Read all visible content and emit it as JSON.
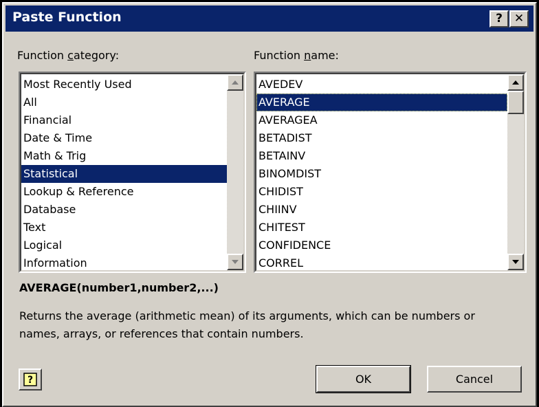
{
  "window": {
    "title": "Paste Function",
    "help_button_label": "?",
    "close_button_label": "✕"
  },
  "category": {
    "label_prefix": "Function ",
    "label_accel": "c",
    "label_suffix": "ategory:",
    "items": [
      "Most Recently Used",
      "All",
      "Financial",
      "Date & Time",
      "Math & Trig",
      "Statistical",
      "Lookup & Reference",
      "Database",
      "Text",
      "Logical",
      "Information"
    ],
    "selected": "Statistical"
  },
  "function": {
    "label_prefix": "Function ",
    "label_accel": "n",
    "label_suffix": "ame:",
    "items": [
      "AVEDEV",
      "AVERAGE",
      "AVERAGEA",
      "BETADIST",
      "BETAINV",
      "BINOMDIST",
      "CHIDIST",
      "CHIINV",
      "CHITEST",
      "CONFIDENCE",
      "CORREL"
    ],
    "selected": "AVERAGE"
  },
  "details": {
    "syntax": "AVERAGE(number1,number2,...)",
    "description": "Returns the average (arithmetic mean) of its arguments, which can be numbers or names, arrays, or references that contain numbers."
  },
  "buttons": {
    "ok": "OK",
    "cancel": "Cancel",
    "help_icon": "?"
  },
  "colors": {
    "titlebar": "#0a246a",
    "selection": "#0a246a",
    "face": "#d4d0c8"
  },
  "icons": {
    "scroll_up": "triangle-up-icon",
    "scroll_down": "triangle-down-icon",
    "office_assistant_help": "help-icon"
  }
}
